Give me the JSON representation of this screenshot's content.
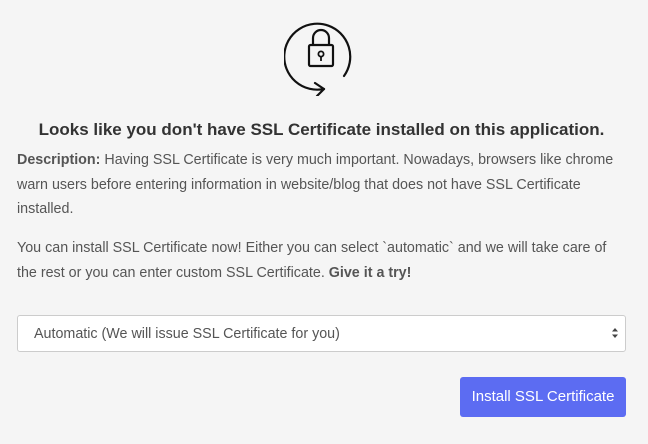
{
  "headline": "Looks like you don't have SSL Certificate installed on this application.",
  "description": {
    "label": "Description:",
    "text": " Having SSL Certificate is very much important. Nowadays, browsers like chrome warn users before entering information in website/blog that does not have SSL Certificate installed."
  },
  "install_note": {
    "text": "You can install SSL Certificate now! Either you can select `automatic` and we will take care of the rest or you can enter custom SSL Certificate. ",
    "emphasis": "Give it a try!"
  },
  "ssl_type_select": {
    "selected": "Automatic (We will issue SSL Certificate for you)"
  },
  "install_button": {
    "label": "Install SSL Certificate"
  },
  "icons": {
    "hero": "lock-refresh-icon",
    "select_caret": "caret-updown-icon"
  },
  "colors": {
    "accent": "#5c6cf2",
    "background": "#f5f5f5",
    "text": "#555555"
  }
}
